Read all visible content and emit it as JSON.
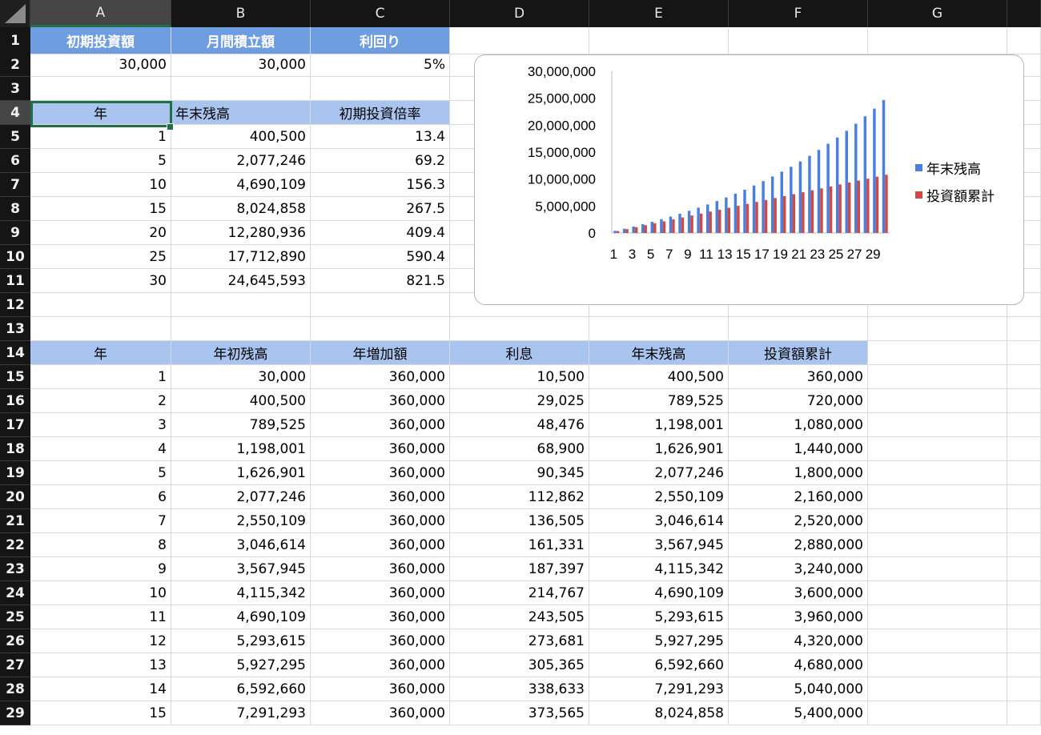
{
  "columns": [
    "A",
    "B",
    "C",
    "D",
    "E",
    "F",
    "G"
  ],
  "rows": [
    "1",
    "2",
    "3",
    "4",
    "5",
    "6",
    "7",
    "8",
    "9",
    "10",
    "11",
    "12",
    "13",
    "14",
    "15",
    "16",
    "17",
    "18",
    "19",
    "20",
    "21",
    "22",
    "23",
    "24",
    "25",
    "26",
    "27",
    "28",
    "29"
  ],
  "inputs": {
    "headers": [
      "初期投資額",
      "月間積立額",
      "利回り"
    ],
    "values": [
      "30,000",
      "30,000",
      "5%"
    ]
  },
  "summary": {
    "headers": [
      "年",
      "年末残高",
      "初期投資倍率"
    ],
    "rows": [
      [
        "1",
        "400,500",
        "13.4"
      ],
      [
        "5",
        "2,077,246",
        "69.2"
      ],
      [
        "10",
        "4,690,109",
        "156.3"
      ],
      [
        "15",
        "8,024,858",
        "267.5"
      ],
      [
        "20",
        "12,280,936",
        "409.4"
      ],
      [
        "25",
        "17,712,890",
        "590.4"
      ],
      [
        "30",
        "24,645,593",
        "821.5"
      ]
    ]
  },
  "detail": {
    "headers": [
      "年",
      "年初残高",
      "年増加額",
      "利息",
      "年末残高",
      "投資額累計"
    ],
    "rows": [
      [
        "1",
        "30,000",
        "360,000",
        "10,500",
        "400,500",
        "360,000"
      ],
      [
        "2",
        "400,500",
        "360,000",
        "29,025",
        "789,525",
        "720,000"
      ],
      [
        "3",
        "789,525",
        "360,000",
        "48,476",
        "1,198,001",
        "1,080,000"
      ],
      [
        "4",
        "1,198,001",
        "360,000",
        "68,900",
        "1,626,901",
        "1,440,000"
      ],
      [
        "5",
        "1,626,901",
        "360,000",
        "90,345",
        "2,077,246",
        "1,800,000"
      ],
      [
        "6",
        "2,077,246",
        "360,000",
        "112,862",
        "2,550,109",
        "2,160,000"
      ],
      [
        "7",
        "2,550,109",
        "360,000",
        "136,505",
        "3,046,614",
        "2,520,000"
      ],
      [
        "8",
        "3,046,614",
        "360,000",
        "161,331",
        "3,567,945",
        "2,880,000"
      ],
      [
        "9",
        "3,567,945",
        "360,000",
        "187,397",
        "4,115,342",
        "3,240,000"
      ],
      [
        "10",
        "4,115,342",
        "360,000",
        "214,767",
        "4,690,109",
        "3,600,000"
      ],
      [
        "11",
        "4,690,109",
        "360,000",
        "243,505",
        "5,293,615",
        "3,960,000"
      ],
      [
        "12",
        "5,293,615",
        "360,000",
        "273,681",
        "5,927,295",
        "4,320,000"
      ],
      [
        "13",
        "5,927,295",
        "360,000",
        "305,365",
        "6,592,660",
        "4,680,000"
      ],
      [
        "14",
        "6,592,660",
        "360,000",
        "338,633",
        "7,291,293",
        "5,040,000"
      ],
      [
        "15",
        "7,291,293",
        "360,000",
        "373,565",
        "8,024,858",
        "5,400,000"
      ]
    ]
  },
  "chart_data": {
    "type": "bar",
    "categories": [
      "1",
      "2",
      "3",
      "4",
      "5",
      "6",
      "7",
      "8",
      "9",
      "10",
      "11",
      "12",
      "13",
      "14",
      "15",
      "16",
      "17",
      "18",
      "19",
      "20",
      "21",
      "22",
      "23",
      "24",
      "25",
      "26",
      "27",
      "28",
      "29",
      "30"
    ],
    "x_tick_labels": [
      "1",
      "3",
      "5",
      "7",
      "9",
      "11",
      "13",
      "15",
      "17",
      "19",
      "21",
      "23",
      "25",
      "27",
      "29"
    ],
    "y_tick_labels": [
      "30,000,000",
      "25,000,000",
      "20,000,000",
      "15,000,000",
      "10,000,000",
      "5,000,000",
      "0"
    ],
    "ylim": [
      0,
      30000000
    ],
    "legend_position": "right",
    "series": [
      {
        "name": "年末残高",
        "color": "#4a7fe0",
        "values": [
          400500,
          789525,
          1198001,
          1626901,
          2077246,
          2550109,
          3046614,
          3567945,
          4115342,
          4690109,
          5293615,
          5927295,
          6592660,
          7291293,
          8024858,
          8804101,
          9622306,
          10481422,
          11383493,
          12280936,
          13272983,
          14314632,
          15408364,
          16556782,
          17712890,
          18956535,
          20262362,
          21633480,
          23073154,
          24645593
        ]
      },
      {
        "name": "投資額累計",
        "color": "#d04a45",
        "values": [
          360000,
          720000,
          1080000,
          1440000,
          1800000,
          2160000,
          2520000,
          2880000,
          3240000,
          3600000,
          3960000,
          4320000,
          4680000,
          5040000,
          5400000,
          5760000,
          6120000,
          6480000,
          6840000,
          7200000,
          7560000,
          7920000,
          8280000,
          8640000,
          9000000,
          9360000,
          9720000,
          10080000,
          10440000,
          10800000
        ]
      }
    ]
  }
}
